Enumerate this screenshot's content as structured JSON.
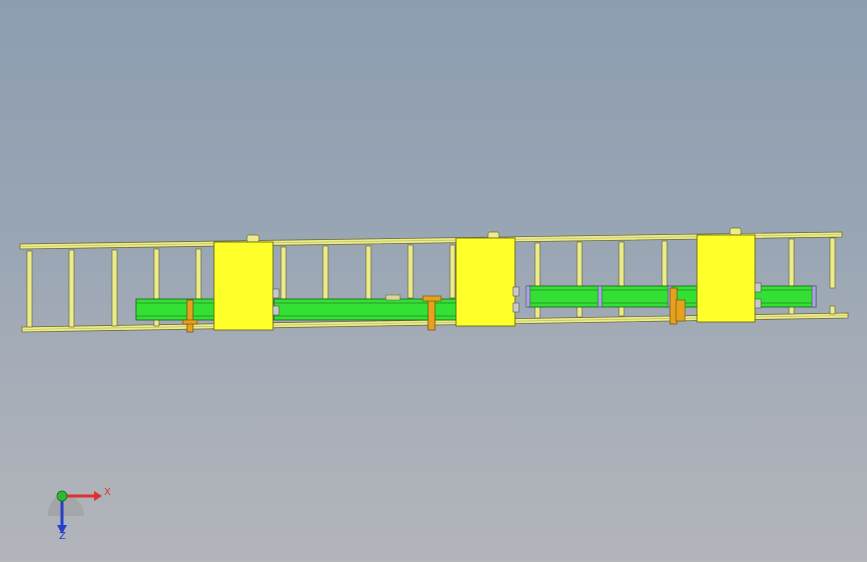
{
  "viewport": {
    "background_top": "#8d9db0",
    "background_bottom": "#b2b5ba"
  },
  "model": {
    "frame_color": "#ecec8a",
    "frame_outline": "#6b6b3a",
    "beam_color": "#33e033",
    "bracket_color": "#ffff2a",
    "clamp_color": "#e6a21e",
    "bracket_count": 3,
    "beam_count": 3
  },
  "triad": {
    "x_label": "X",
    "z_label": "Z",
    "x_color": "#e03030",
    "y_color": "#2db82d",
    "z_color": "#2540c8"
  }
}
